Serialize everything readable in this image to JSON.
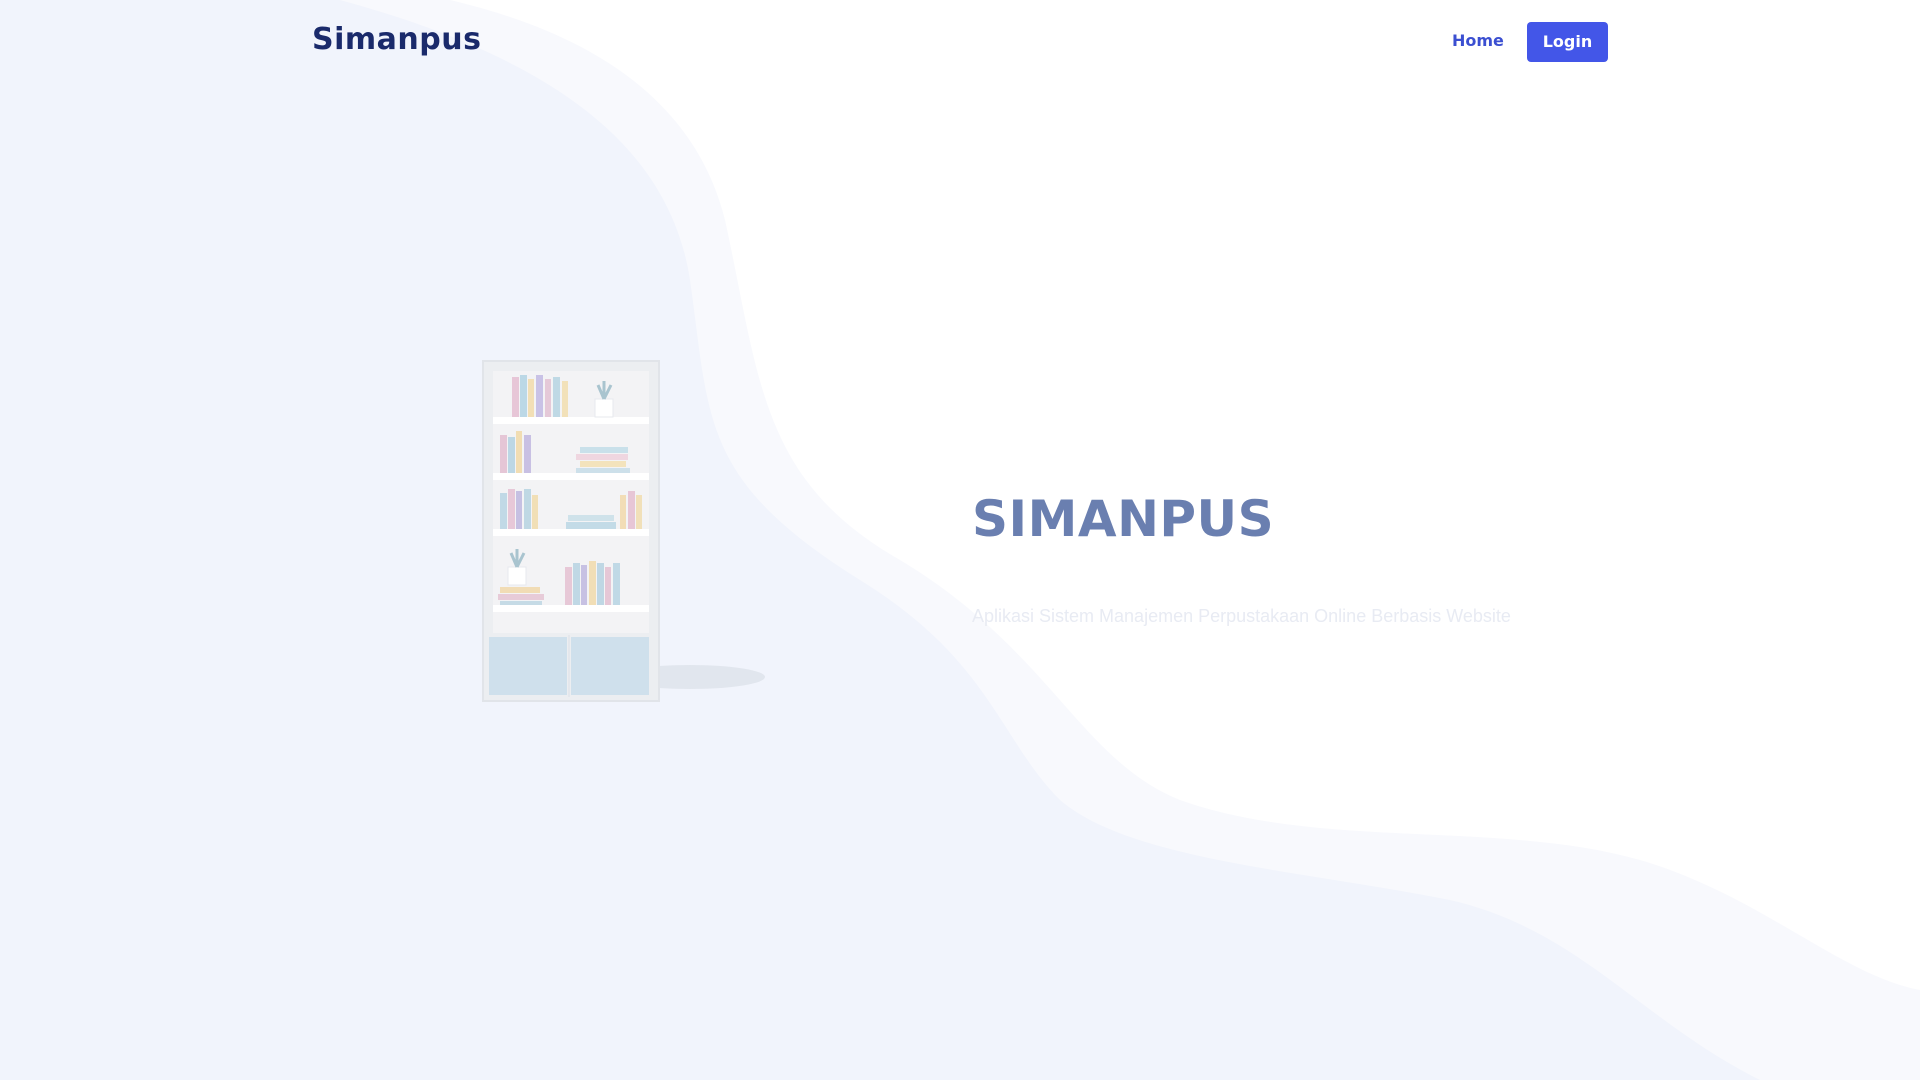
{
  "navbar": {
    "brand": "Simanpus",
    "home_label": "Home",
    "login_label": "Login"
  },
  "hero": {
    "title": "SIMANPUS",
    "subtitle": "Aplikasi Sistem Manajemen Perpustakaan Online Berbasis Website",
    "illustration": "bookshelf-illustration"
  },
  "colors": {
    "brand_text": "#1a2a6b",
    "accent": "#4356e8",
    "link": "#3b4fd1",
    "hero_title": "#6a7fb0",
    "background_wave": "#f1f4fb"
  }
}
